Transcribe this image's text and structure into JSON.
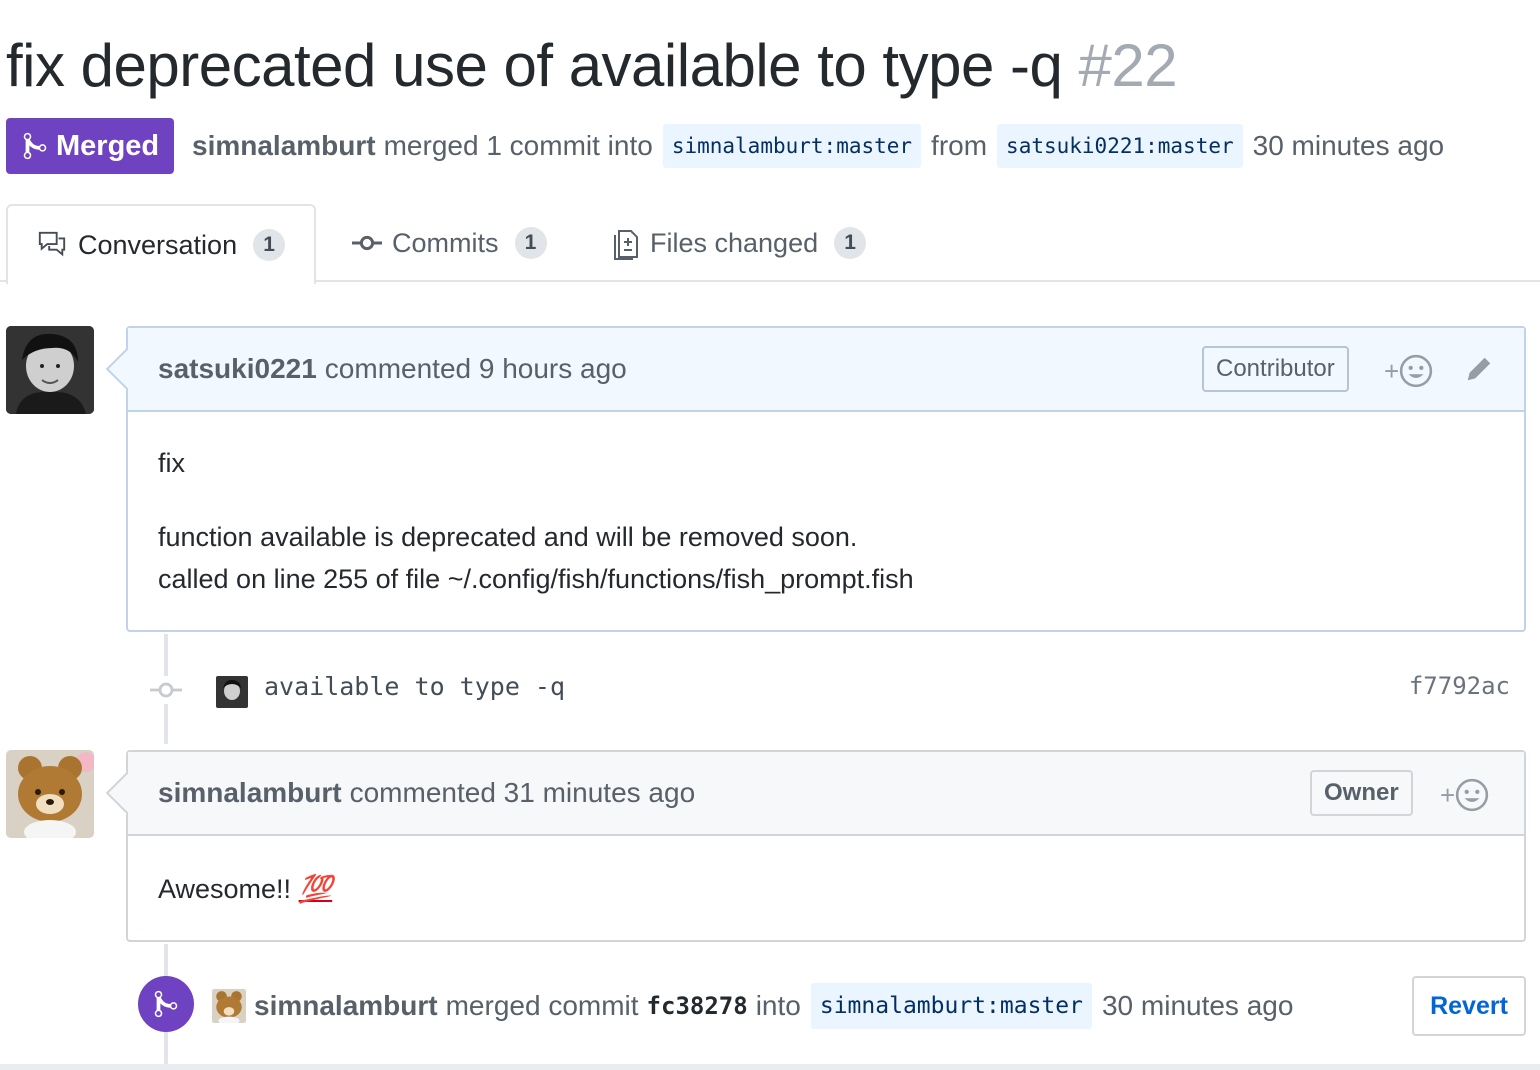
{
  "pr": {
    "title": "fix deprecated use of available to type -q",
    "number": "#22",
    "state": "Merged",
    "merger": "simnalamburt",
    "merged_text": "merged 1 commit into",
    "base_branch": "simnalamburt:master",
    "from_text": "from",
    "head_branch": "satsuki0221:master",
    "time": "30 minutes ago"
  },
  "tabs": [
    {
      "label": "Conversation",
      "count": "1"
    },
    {
      "label": "Commits",
      "count": "1"
    },
    {
      "label": "Files changed",
      "count": "1"
    }
  ],
  "comment1": {
    "author": "satsuki0221",
    "action": "commented 9 hours ago",
    "role": "Contributor",
    "body": [
      "fix",
      "function available is deprecated and will be removed soon.",
      "called on line 255 of file ~/.config/fish/functions/fish_prompt.fish"
    ]
  },
  "commit": {
    "message": "available to type -q",
    "sha": "f7792ac"
  },
  "comment2": {
    "author": "simnalamburt",
    "action": "commented 31 minutes ago",
    "role": "Owner",
    "body": "Awesome!!",
    "emoji": "💯"
  },
  "merge_event": {
    "author": "simnalamburt",
    "text": "merged commit",
    "sha": "fc38278",
    "into": "into",
    "branch": "simnalamburt:master",
    "time": "30 minutes ago",
    "revert": "Revert"
  },
  "colors": {
    "merged_purple": "#6f42c1",
    "link_blue": "#0366d6",
    "branch_bg": "#eaf5ff"
  }
}
